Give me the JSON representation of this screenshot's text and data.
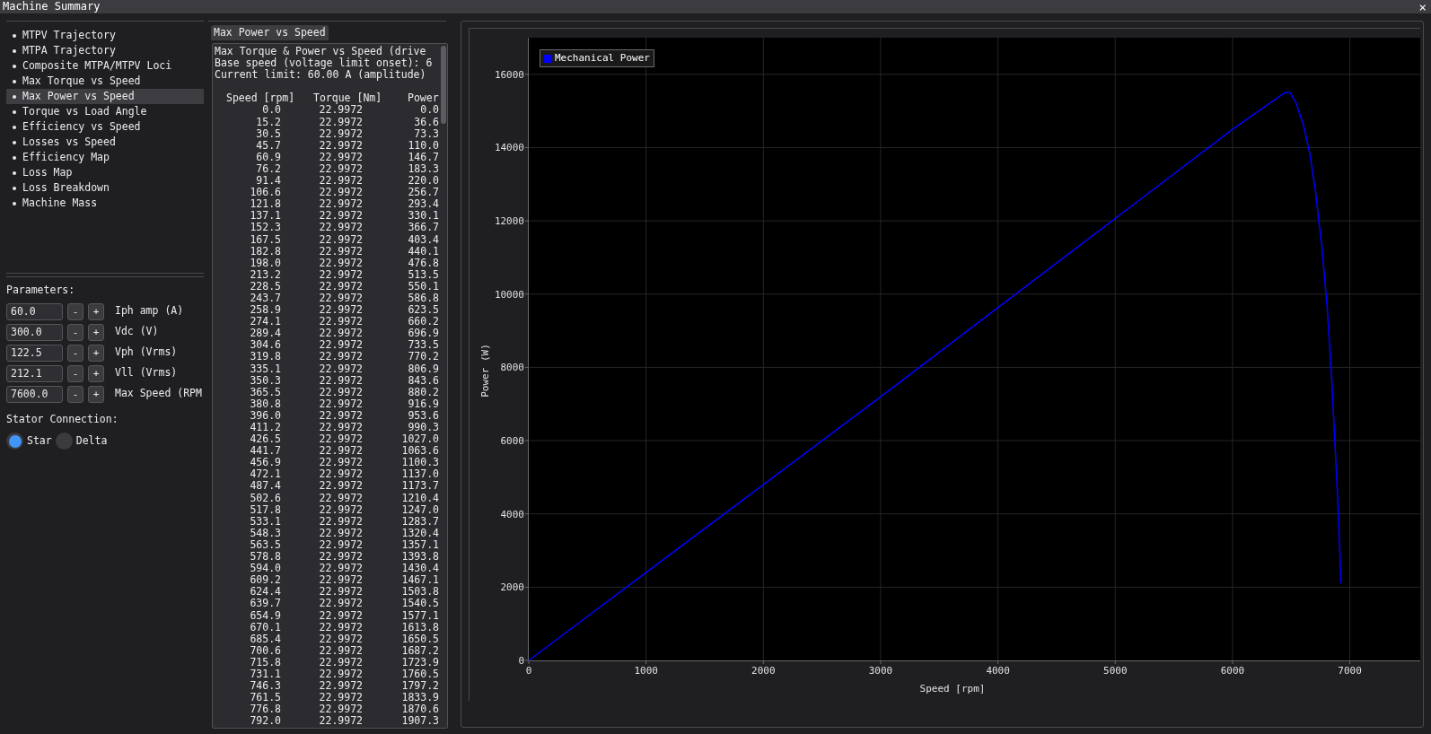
{
  "window": {
    "title": "Machine Summary",
    "close": "×"
  },
  "sidebar": {
    "items": [
      {
        "label": "MTPV Trajectory",
        "selected": false
      },
      {
        "label": "MTPA Trajectory",
        "selected": false
      },
      {
        "label": "Composite MTPA/MTPV Loci",
        "selected": false
      },
      {
        "label": "Max Torque vs Speed",
        "selected": false
      },
      {
        "label": "Max Power vs Speed",
        "selected": true
      },
      {
        "label": "Torque vs Load Angle",
        "selected": false
      },
      {
        "label": "Efficiency vs Speed",
        "selected": false
      },
      {
        "label": "Losses vs Speed",
        "selected": false
      },
      {
        "label": "Efficiency Map",
        "selected": false
      },
      {
        "label": "Loss Map",
        "selected": false
      },
      {
        "label": "Loss Breakdown",
        "selected": false
      },
      {
        "label": "Machine Mass",
        "selected": false
      }
    ]
  },
  "parameters": {
    "title": "Parameters:",
    "fields": [
      {
        "value": "60.0",
        "minus": "-",
        "plus": "+",
        "label": "Iph amp (A)"
      },
      {
        "value": "300.0",
        "minus": "-",
        "plus": "+",
        "label": "Vdc (V)"
      },
      {
        "value": "122.5",
        "minus": "-",
        "plus": "+",
        "label": "Vph (Vrms)"
      },
      {
        "value": "212.1",
        "minus": "-",
        "plus": "+",
        "label": "Vll (Vrms)"
      },
      {
        "value": "7600.0",
        "minus": "-",
        "plus": "+",
        "label": "Max Speed (RPM"
      }
    ],
    "connection": {
      "title": "Stator Connection:",
      "options": [
        {
          "label": "Star",
          "selected": true
        },
        {
          "label": "Delta",
          "selected": false
        }
      ]
    }
  },
  "tabs": [
    {
      "label": "Max Power vs Speed",
      "selected": true
    }
  ],
  "report": {
    "lines": [
      "Max Torque & Power vs Speed (drive",
      "Base speed (voltage limit onset): 6",
      "Current limit: 60.00 A (amplitude)"
    ],
    "columns": [
      "Speed [rpm]",
      "Torque [Nm]",
      "Power"
    ],
    "rows": [
      [
        "0.0",
        "22.9972",
        "0.0"
      ],
      [
        "15.2",
        "22.9972",
        "36.6"
      ],
      [
        "30.5",
        "22.9972",
        "73.3"
      ],
      [
        "45.7",
        "22.9972",
        "110.0"
      ],
      [
        "60.9",
        "22.9972",
        "146.7"
      ],
      [
        "76.2",
        "22.9972",
        "183.3"
      ],
      [
        "91.4",
        "22.9972",
        "220.0"
      ],
      [
        "106.6",
        "22.9972",
        "256.7"
      ],
      [
        "121.8",
        "22.9972",
        "293.4"
      ],
      [
        "137.1",
        "22.9972",
        "330.1"
      ],
      [
        "152.3",
        "22.9972",
        "366.7"
      ],
      [
        "167.5",
        "22.9972",
        "403.4"
      ],
      [
        "182.8",
        "22.9972",
        "440.1"
      ],
      [
        "198.0",
        "22.9972",
        "476.8"
      ],
      [
        "213.2",
        "22.9972",
        "513.5"
      ],
      [
        "228.5",
        "22.9972",
        "550.1"
      ],
      [
        "243.7",
        "22.9972",
        "586.8"
      ],
      [
        "258.9",
        "22.9972",
        "623.5"
      ],
      [
        "274.1",
        "22.9972",
        "660.2"
      ],
      [
        "289.4",
        "22.9972",
        "696.9"
      ],
      [
        "304.6",
        "22.9972",
        "733.5"
      ],
      [
        "319.8",
        "22.9972",
        "770.2"
      ],
      [
        "335.1",
        "22.9972",
        "806.9"
      ],
      [
        "350.3",
        "22.9972",
        "843.6"
      ],
      [
        "365.5",
        "22.9972",
        "880.2"
      ],
      [
        "380.8",
        "22.9972",
        "916.9"
      ],
      [
        "396.0",
        "22.9972",
        "953.6"
      ],
      [
        "411.2",
        "22.9972",
        "990.3"
      ],
      [
        "426.5",
        "22.9972",
        "1027.0"
      ],
      [
        "441.7",
        "22.9972",
        "1063.6"
      ],
      [
        "456.9",
        "22.9972",
        "1100.3"
      ],
      [
        "472.1",
        "22.9972",
        "1137.0"
      ],
      [
        "487.4",
        "22.9972",
        "1173.7"
      ],
      [
        "502.6",
        "22.9972",
        "1210.4"
      ],
      [
        "517.8",
        "22.9972",
        "1247.0"
      ],
      [
        "533.1",
        "22.9972",
        "1283.7"
      ],
      [
        "548.3",
        "22.9972",
        "1320.4"
      ],
      [
        "563.5",
        "22.9972",
        "1357.1"
      ],
      [
        "578.8",
        "22.9972",
        "1393.8"
      ],
      [
        "594.0",
        "22.9972",
        "1430.4"
      ],
      [
        "609.2",
        "22.9972",
        "1467.1"
      ],
      [
        "624.4",
        "22.9972",
        "1503.8"
      ],
      [
        "639.7",
        "22.9972",
        "1540.5"
      ],
      [
        "654.9",
        "22.9972",
        "1577.1"
      ],
      [
        "670.1",
        "22.9972",
        "1613.8"
      ],
      [
        "685.4",
        "22.9972",
        "1650.5"
      ],
      [
        "700.6",
        "22.9972",
        "1687.2"
      ],
      [
        "715.8",
        "22.9972",
        "1723.9"
      ],
      [
        "731.1",
        "22.9972",
        "1760.5"
      ],
      [
        "746.3",
        "22.9972",
        "1797.2"
      ],
      [
        "761.5",
        "22.9972",
        "1833.9"
      ],
      [
        "776.8",
        "22.9972",
        "1870.6"
      ],
      [
        "792.0",
        "22.9972",
        "1907.3"
      ]
    ]
  },
  "chart": {
    "chart_data": {
      "type": "line",
      "xlabel": "Speed [rpm]",
      "ylabel": "Power (W)",
      "x": [
        0,
        3000,
        6000,
        6400,
        6448,
        6490,
        6544,
        6606,
        6661,
        6707,
        6761,
        6808,
        6847,
        6878,
        6901,
        6924
      ],
      "series": [
        {
          "name": "Mechanical Power",
          "color": "#0000ff",
          "values": [
            0,
            7200,
            14500,
            15400,
            15500,
            15500,
            15200,
            14600,
            13800,
            12800,
            11300,
            9600,
            7600,
            5600,
            4100,
            2100
          ]
        }
      ],
      "grid": true,
      "xlim": [
        0,
        7600
      ],
      "ylim": [
        0,
        17000
      ],
      "xticks": [
        0,
        1000,
        2000,
        3000,
        4000,
        5000,
        6000,
        7000
      ],
      "yticks": [
        0,
        2000,
        4000,
        6000,
        8000,
        10000,
        12000,
        14000,
        16000
      ]
    }
  }
}
